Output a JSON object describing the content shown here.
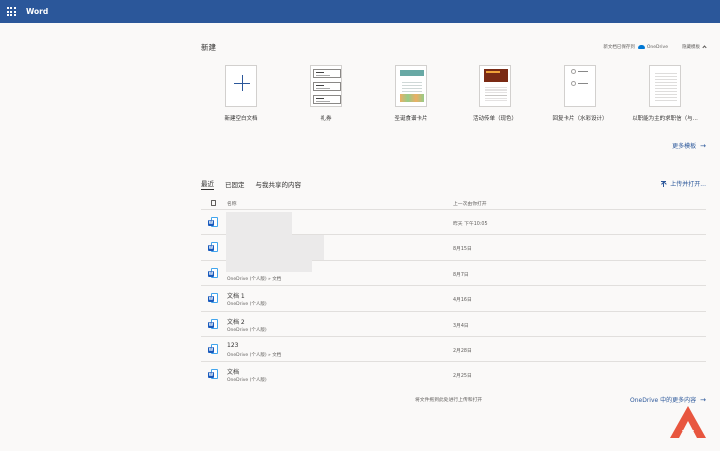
{
  "app": {
    "name": "Word"
  },
  "new_section": {
    "title": "新建",
    "save_location_text": "新文档已保存到",
    "save_location_service": "OneDrive",
    "hide_templates_label": "隐藏模板",
    "more_templates_label": "更多模板",
    "templates": [
      {
        "id": "blank",
        "label": "新建空白文档"
      },
      {
        "id": "coupon",
        "label": "礼券"
      },
      {
        "id": "christmas-card",
        "label": "圣诞食谱卡片"
      },
      {
        "id": "event-flyer",
        "label": "活动传单（现色）"
      },
      {
        "id": "reply-card",
        "label": "回复卡片（水彩设计）"
      },
      {
        "id": "skills-resume",
        "label": "以职能为主的求职信（与..."
      }
    ]
  },
  "recent_section": {
    "tabs": [
      {
        "id": "recent",
        "label": "最近",
        "active": true
      },
      {
        "id": "pinned",
        "label": "已固定",
        "active": false
      },
      {
        "id": "shared",
        "label": "与我共享的内容",
        "active": false
      }
    ],
    "upload_open_label": "上传并打开...",
    "columns": {
      "name": "名称",
      "last_opened": "上一次由你打开"
    },
    "files": [
      {
        "name": "",
        "location": "",
        "date": "昨天 下午10:05"
      },
      {
        "name": "",
        "location": "",
        "date": "8月15日"
      },
      {
        "name": "",
        "location": "OneDrive (个人版) » 文档",
        "date": "8月7日"
      },
      {
        "name": "文档 1",
        "location": "OneDrive (个人版)",
        "date": "4月16日"
      },
      {
        "name": "文档 2",
        "location": "OneDrive (个人版)",
        "date": "3月4日"
      },
      {
        "name": "123",
        "location": "OneDrive (个人版) » 文档",
        "date": "2月28日"
      },
      {
        "name": "文档",
        "location": "OneDrive (个人版)",
        "date": "2月25日"
      }
    ],
    "bottom_hint": "将文件拖到此处进行上传和打开",
    "more_onedrive_label": "OneDrive 中的更多内容"
  },
  "colors": {
    "brand": "#2b579a",
    "word_icon": "#185abd",
    "watermark": "#e8563f"
  }
}
